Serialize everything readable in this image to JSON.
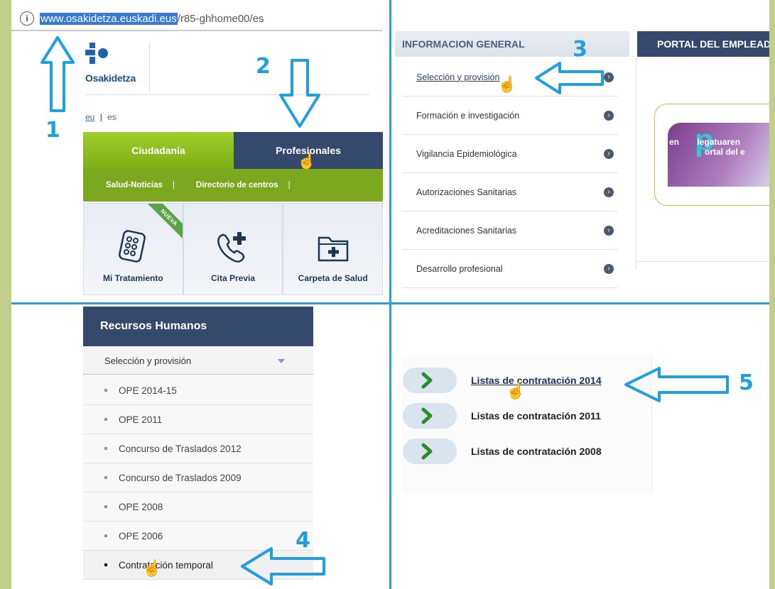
{
  "browser": {
    "url_host": "www.osakidetza.euskadi.eus",
    "url_path": "/r85-ghhome00/es",
    "info_icon": "info-icon"
  },
  "home": {
    "logo_text": "Osakidetza",
    "lang_eu": "eu",
    "lang_sep": "|",
    "lang_es": "es",
    "tab_ciudadania": "Ciudadanía",
    "tab_profesionales": "Profesionales",
    "nav": [
      "Salud-Noticias",
      "Directorio de centros"
    ],
    "nav_sep": "|",
    "tiles": [
      {
        "label": "Mi Tratamiento",
        "icon": "pills-icon"
      },
      {
        "label": "Cita Previa",
        "icon": "phone-plus-icon"
      },
      {
        "label": "Carpeta de Salud",
        "icon": "health-folder-icon"
      }
    ],
    "nueva_badge": "NUEVA"
  },
  "info": {
    "header": "INFORMACION GENERAL",
    "items": [
      "Selección y provisión",
      "Formación e investigación",
      "Vigilancia Epidemiológica",
      "Autorizaciones Sanitarias",
      "Acreditaciones Sanitarias",
      "Desarrollo profesional"
    ],
    "bullet_glyph": "›",
    "portal_header": "PORTAL DEL EMPLEADO",
    "portal_banner_text_1": "en",
    "portal_banner_text_2": "legatuaren",
    "portal_banner_text_3": "ortal del e",
    "portal_banner_p": "p"
  },
  "rrhh": {
    "header": "Recursos Humanos",
    "sub": "Selección y provisión",
    "items": [
      "OPE 2014-15",
      "OPE 2011",
      "Concurso de Traslados 2012",
      "Concurso de Traslados 2009",
      "OPE 2008",
      "OPE 2006",
      "Contratación temporal"
    ]
  },
  "listas": {
    "items": [
      "Listas de contratación 2014",
      "Listas de contratación 2011",
      "Listas de contratación 2008"
    ]
  },
  "annotations": {
    "step1": "1",
    "step2": "2",
    "step3": "3",
    "step4": "4",
    "step5": "5",
    "cursor_glyph": "☝",
    "color": "#1f9ee0"
  }
}
